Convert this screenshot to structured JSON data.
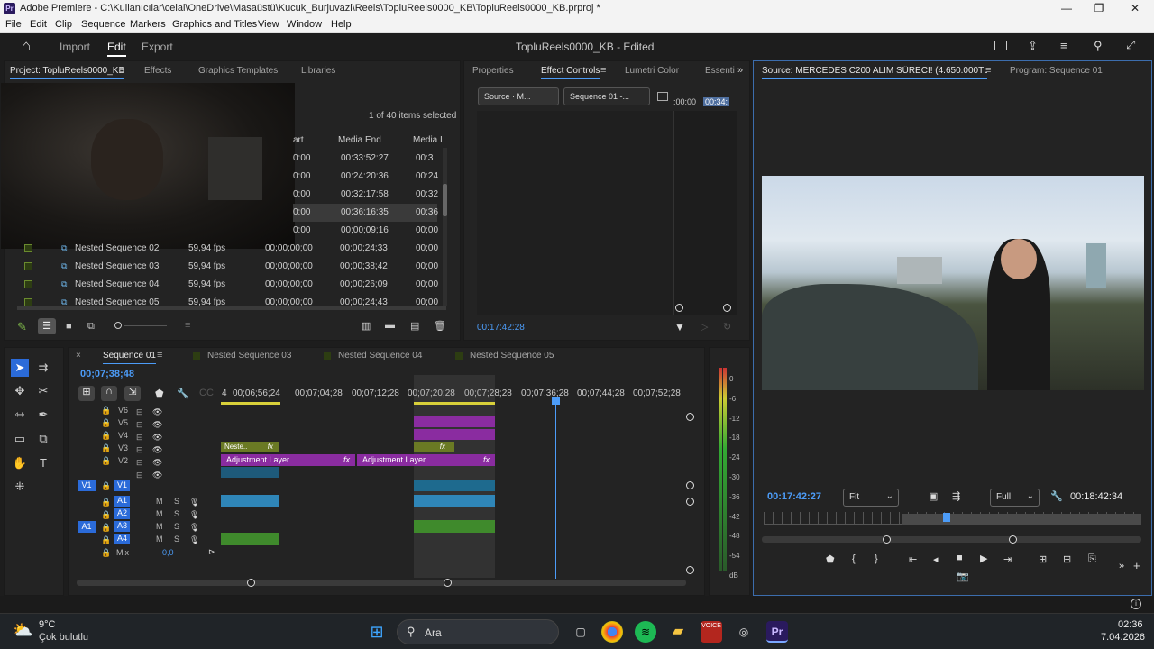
{
  "titlebar": {
    "app_badge": "Pr",
    "title": "Adobe Premiere - C:\\Kullanıcılar\\celal\\OneDrive\\Masaüstü\\Kucuk_Burjuvazi\\Reels\\TopluReels0000_KB\\TopluReels0000_KB.prproj *",
    "min": "—",
    "max": "❐",
    "close": "✕"
  },
  "menu": [
    "File",
    "Edit",
    "Clip",
    "Sequence",
    "Markers",
    "Graphics and Titles",
    "View",
    "Window",
    "Help"
  ],
  "appbar": {
    "home": "⌂",
    "tabs": [
      "Import",
      "Edit",
      "Export"
    ],
    "active": "Edit",
    "center_title": "TopluReels0000_KB - Edited"
  },
  "project": {
    "tabs": [
      "Project: TopluReels0000_KB",
      "Effects",
      "Graphics Templates",
      "Libraries"
    ],
    "selection_info": "1 of 40 items selected",
    "columns": [
      "art",
      "Media End",
      "Media I"
    ],
    "rows_top": [
      [
        "0:00",
        "00:33:52:27",
        "00:3"
      ],
      [
        "0:00",
        "00:24:20:36",
        "00:24"
      ],
      [
        "0:00",
        "00:32:17:58",
        "00:32"
      ],
      [
        "0:00",
        "00:36:16:35",
        "00:36"
      ],
      [
        "0:00",
        "00;00;09;16",
        "00;00"
      ]
    ],
    "rows": [
      {
        "name": "Nested Sequence 02",
        "fps": "59,94 fps",
        "start": "00;00;00;00",
        "end": "00;00;24;33",
        "mi": "00;00"
      },
      {
        "name": "Nested Sequence 03",
        "fps": "59,94 fps",
        "start": "00;00;00;00",
        "end": "00;00;38;42",
        "mi": "00;00"
      },
      {
        "name": "Nested Sequence 04",
        "fps": "59,94 fps",
        "start": "00;00;00;00",
        "end": "00;00;26;09",
        "mi": "00;00"
      },
      {
        "name": "Nested Sequence 05",
        "fps": "59,94 fps",
        "start": "00;00;00;00",
        "end": "00;00;24;43",
        "mi": "00;00"
      }
    ]
  },
  "effect_controls": {
    "tabs": [
      "Properties",
      "Effect Controls",
      "Lumetri Color",
      "Essenti"
    ],
    "src_btn": "Source · M...",
    "seq_btn": "Sequence 01 -...",
    "mini_tc": ":00:00",
    "mini_tc2": "00:34:",
    "timecode": "00:17:42:28"
  },
  "source_monitor": {
    "tabs": [
      "Source: MERCEDES C200 ALIM SÜRECİ! (4.650.000TL).mp4",
      "Program: Sequence 01"
    ],
    "timecode": "00:17:42:27",
    "fit": "Fit",
    "quality": "Full",
    "duration": "00:18:42:34"
  },
  "timeline": {
    "tabs": [
      "Sequence 01",
      "Nested Sequence 03",
      "Nested Sequence 04",
      "Nested Sequence 05"
    ],
    "timecode": "00;07;38;48",
    "ruler": [
      "4",
      "00;06;56;24",
      "00;07;04;28",
      "00;07;12;28",
      "00;07;20;28",
      "00;07;28;28",
      "00;07;36;28",
      "00;07;44;28",
      "00;07;52;28"
    ],
    "video_tracks": [
      "V6",
      "V5",
      "V4",
      "V3",
      "V2",
      "V1"
    ],
    "audio_tracks": [
      "A1",
      "A2",
      "A3",
      "A4"
    ],
    "mix_label": "Mix",
    "mix_value": "0,0",
    "clip_nested": "Neste..",
    "clip_adj1": "Adjustment Layer",
    "clip_adj2": "Adjustment Layer",
    "fx": "fx",
    "src_v1": "V1",
    "src_a1": "A1",
    "m": "M",
    "s": "S"
  },
  "meter": {
    "scale": [
      "0",
      "-6",
      "-12",
      "-18",
      "-24",
      "-30",
      "-36",
      "-42",
      "-48",
      "-54",
      "dB"
    ]
  },
  "taskbar": {
    "temp": "9°C",
    "weather": "Çok bulutlu",
    "search": "Ara",
    "time": "02:36",
    "date": "7.04.2026"
  }
}
